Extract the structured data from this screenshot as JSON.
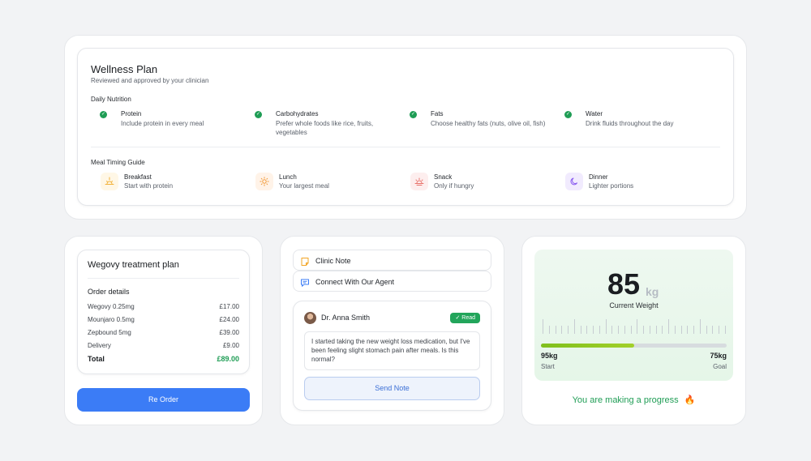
{
  "wellness": {
    "title": "Wellness Plan",
    "subtitle": "Reviewed and approved by your clinician",
    "nutrition_label": "Daily Nutrition",
    "nutrition": [
      {
        "title": "Protein",
        "desc": "Include protein in every meal"
      },
      {
        "title": "Carbohydrates",
        "desc": "Prefer whole foods like rice, fruits, vegetables"
      },
      {
        "title": "Fats",
        "desc": "Choose healthy fats (nuts, olive oil, fish)"
      },
      {
        "title": "Water",
        "desc": "Drink fluids throughout the day"
      }
    ],
    "meal_label": "Meal Timing Guide",
    "meals": [
      {
        "title": "Breakfast",
        "desc": "Start with protein",
        "icon": "sunrise-icon",
        "color": "#f2b23a",
        "bg": "#fff7e6"
      },
      {
        "title": "Lunch",
        "desc": "Your largest meal",
        "icon": "sun-icon",
        "color": "#f29a3a",
        "bg": "#fff3e8"
      },
      {
        "title": "Snack",
        "desc": "Only if hungry",
        "icon": "sunset-icon",
        "color": "#e8726b",
        "bg": "#fdeeee"
      },
      {
        "title": "Dinner",
        "desc": "Lighter portions",
        "icon": "moon-icon",
        "color": "#8a5cf0",
        "bg": "#f1ebfe"
      }
    ]
  },
  "order": {
    "title": "Wegovy treatment plan",
    "details_label": "Order details",
    "items": [
      {
        "label": "Wegovy 0.25mg",
        "amount": "£17.00"
      },
      {
        "label": "Mounjaro 0.5mg",
        "amount": "£24.00"
      },
      {
        "label": "Zepbound 5mg",
        "amount": "£39.00"
      },
      {
        "label": "Delivery",
        "amount": "£9.00"
      }
    ],
    "total_label": "Total",
    "total_amount": "£89.00",
    "reorder_label": "Re Order"
  },
  "notes": {
    "clinic_note_label": "Clinic Note",
    "agent_label": "Connect With Our Agent",
    "doctor_name": "Dr. Anna Smith",
    "read_badge": "Read",
    "message": "I started taking the new weight loss medication, but I've been feeling slight stomach pain after meals. Is this normal?",
    "send_label": "Send Note"
  },
  "weight": {
    "current": "85",
    "unit": "kg",
    "caption": "Current Weight",
    "start_value": "95kg",
    "start_label": "Start",
    "goal_value": "75kg",
    "goal_label": "Goal",
    "progress_fraction": 0.5,
    "message": "You are making a progress",
    "message_emoji": "🔥"
  },
  "colors": {
    "accent_blue": "#3b7cf6",
    "success_green": "#1f9d55",
    "progress_green": "#8cc625"
  }
}
